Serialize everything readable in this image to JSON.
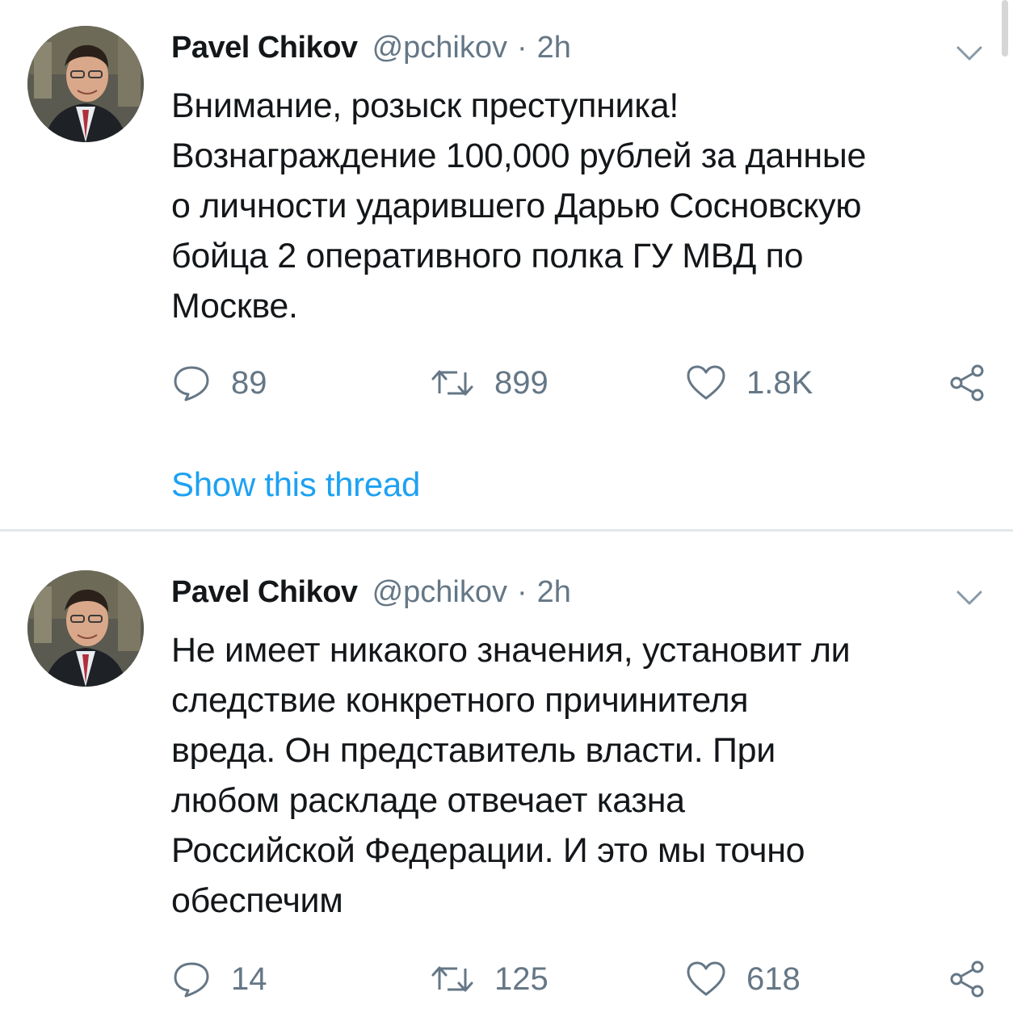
{
  "tweets": [
    {
      "author_name": "Pavel Chikov",
      "handle": "@pchikov",
      "separator": "·",
      "time": "2h",
      "text_lines": [
        "Внимание, розыск преступника!",
        "Вознаграждение 100,000 рублей за данные",
        "о личности ударившего Дарью Сосновскую",
        "бойца 2 оперативного полка ГУ МВД по",
        "Москве."
      ],
      "replies": "89",
      "retweets": "899",
      "likes": "1.8K",
      "thread_link": "Show this thread"
    },
    {
      "author_name": "Pavel Chikov",
      "handle": "@pchikov",
      "separator": "·",
      "time": "2h",
      "text_lines": [
        "Не имеет никакого значения, установит ли",
        "следствие конкретного причинителя",
        "вреда. Он представитель власти. При",
        "любом раскладе отвечает казна",
        "Российской Федерации. И это мы точно",
        "обеспечим"
      ],
      "replies": "14",
      "retweets": "125",
      "likes": "618"
    }
  ],
  "icons": {
    "reply": "reply-icon",
    "retweet": "retweet-icon",
    "like": "like-icon",
    "share": "share-icon",
    "menu": "chevron-down-icon"
  },
  "colors": {
    "text": "#14171a",
    "secondary": "#657786",
    "link": "#1da1f2",
    "divider": "#e1e8ed"
  }
}
